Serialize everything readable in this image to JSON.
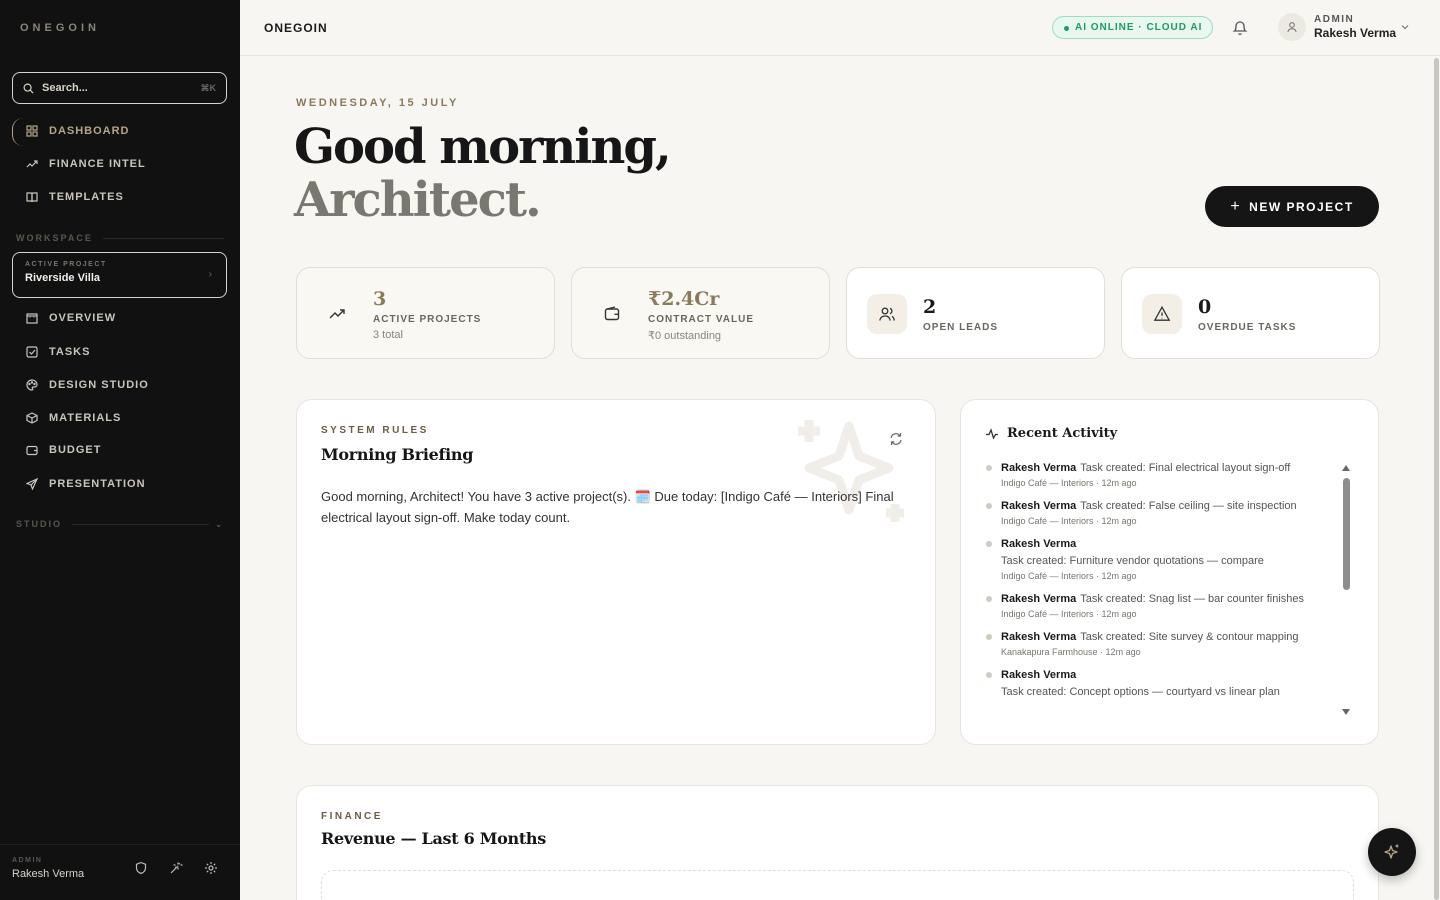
{
  "sidebar": {
    "brand": "ONEGOIN",
    "search": {
      "placeholder": "Search...",
      "shortcut": "⌘K"
    },
    "nav_main": [
      {
        "label": "DASHBOARD",
        "icon": "grid-icon",
        "active": true
      },
      {
        "label": "FINANCE INTEL",
        "icon": "trend-icon"
      },
      {
        "label": "TEMPLATES",
        "icon": "book-icon"
      }
    ],
    "workspace_label": "WORKSPACE",
    "active_project": {
      "label": "ACTIVE PROJECT",
      "value": "Riverside Villa"
    },
    "nav_workspace": [
      {
        "label": "OVERVIEW",
        "icon": "building-icon"
      },
      {
        "label": "TASKS",
        "icon": "checkbox-icon"
      },
      {
        "label": "DESIGN STUDIO",
        "icon": "palette-icon"
      },
      {
        "label": "MATERIALS",
        "icon": "box-icon"
      },
      {
        "label": "BUDGET",
        "icon": "wallet-icon"
      },
      {
        "label": "PRESENTATION",
        "icon": "send-icon"
      }
    ],
    "studio_label": "STUDIO",
    "footer": {
      "role": "ADMIN",
      "name": "Rakesh Verma"
    }
  },
  "topbar": {
    "title": "ONEGOIN",
    "ai_status": "AI ONLINE · CLOUD AI",
    "user_role": "ADMIN",
    "user_name": "Rakesh Verma"
  },
  "hero": {
    "date": "WEDNESDAY, 15 JULY",
    "greeting_line1": "Good morning,",
    "greeting_line2": "Architect.",
    "new_project": "NEW PROJECT"
  },
  "stats": [
    {
      "value": "3",
      "label": "ACTIVE PROJECTS",
      "sub": "3 total",
      "icon": "trend-up-icon"
    },
    {
      "value": "₹2.4Cr",
      "label": "CONTRACT VALUE",
      "sub": "₹0 outstanding",
      "icon": "wallet-icon"
    },
    {
      "value": "2",
      "label": "OPEN LEADS",
      "icon": "users-icon"
    },
    {
      "value": "0",
      "label": "OVERDUE TASKS",
      "icon": "warning-icon"
    }
  ],
  "briefing": {
    "kicker": "SYSTEM RULES",
    "title": "Morning Briefing",
    "text": "Good morning, Architect! You have 3 active project(s). 🗓️ Due today: [Indigo Café — Interiors] Final electrical layout sign-off. Make today count."
  },
  "activity": {
    "title": "Recent Activity",
    "items": [
      {
        "who": "Rakesh Verma",
        "what": "Task created: Final electrical layout sign-off",
        "meta": "Indigo Café — Interiors · 12m ago"
      },
      {
        "who": "Rakesh Verma",
        "what": "Task created: False ceiling — site inspection",
        "meta": "Indigo Café — Interiors · 12m ago"
      },
      {
        "who": "Rakesh Verma",
        "what": "Task created: Furniture vendor quotations — compare",
        "meta": "Indigo Café — Interiors · 12m ago"
      },
      {
        "who": "Rakesh Verma",
        "what": "Task created: Snag list — bar counter finishes",
        "meta": "Indigo Café — Interiors · 12m ago"
      },
      {
        "who": "Rakesh Verma",
        "what": "Task created: Site survey & contour mapping",
        "meta": "Kanakapura Farmhouse · 12m ago"
      },
      {
        "who": "Rakesh Verma",
        "what": "Task created: Concept options — courtyard vs linear plan",
        "meta": ""
      }
    ]
  },
  "finance": {
    "kicker": "FINANCE",
    "title": "Revenue — Last 6 Months"
  }
}
